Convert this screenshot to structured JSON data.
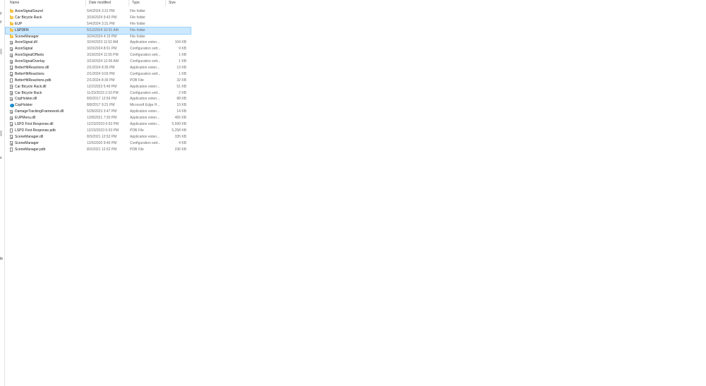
{
  "columns": {
    "name": "Name",
    "date": "Date modified",
    "type": "Type",
    "size": "Size"
  },
  "sidebar_glyphs": [
    "y",
    "y",
    "s",
    "ib"
  ],
  "selected_index": 3,
  "files": [
    {
      "name": "AxonSignalSound",
      "date": "5/4/2024 3:31 PM",
      "type": "File folder",
      "size": "",
      "icon": "folder-icon"
    },
    {
      "name": "Car Bicycle Rack",
      "date": "3/18/2024 9:43 PM",
      "type": "File folder",
      "size": "",
      "icon": "folder-icon"
    },
    {
      "name": "EUP",
      "date": "5/4/2024 3:31 PM",
      "type": "File folder",
      "size": "",
      "icon": "folder-icon"
    },
    {
      "name": "LSPDFR",
      "date": "5/12/2024 10:51 AM",
      "type": "File folder",
      "size": "",
      "icon": "folder-icon"
    },
    {
      "name": "SceneManager",
      "date": "3/24/2024 4:15 PM",
      "type": "File folder",
      "size": "",
      "icon": "folder-icon"
    },
    {
      "name": "AxonSignal.dll",
      "date": "3/24/2023 11:52 AM",
      "type": "Application exten...",
      "size": "104 KB",
      "icon": "dll-icon"
    },
    {
      "name": "AxonSignal",
      "date": "3/20/2024 8:01 PM",
      "type": "Configuration sett...",
      "size": "9 KB",
      "icon": "config-icon"
    },
    {
      "name": "AxonSignalOffsets",
      "date": "3/18/2024 11:55 PM",
      "type": "Configuration sett...",
      "size": "1 KB",
      "icon": "config-icon"
    },
    {
      "name": "AxonSignalOverlay",
      "date": "3/19/2024 12:06 AM",
      "type": "Configuration sett...",
      "size": "1 KB",
      "icon": "config-icon"
    },
    {
      "name": "BetterHitReactions.dll",
      "date": "2/1/2024 8:35 PM",
      "type": "Application exten...",
      "size": "13 KB",
      "icon": "dll-icon"
    },
    {
      "name": "BetterHitReactions",
      "date": "2/1/2024 9:03 PM",
      "type": "Configuration sett...",
      "size": "1 KB",
      "icon": "config-icon"
    },
    {
      "name": "BetterHitReactions.pdb",
      "date": "2/1/2024 8:35 PM",
      "type": "PDB File",
      "size": "32 KB",
      "icon": "file-icon"
    },
    {
      "name": "Car Bicycle Rack.dll",
      "date": "12/2/2023 5:49 PM",
      "type": "Application exten...",
      "size": "51 KB",
      "icon": "dll-icon"
    },
    {
      "name": "Car Bicycle Rack",
      "date": "11/23/2023 2:33 PM",
      "type": "Configuration sett...",
      "size": "2 KB",
      "icon": "config-icon"
    },
    {
      "name": "CopHolster.dll",
      "date": "8/9/2017 12:56 PM",
      "type": "Application exten...",
      "size": "88 KB",
      "icon": "dll-icon"
    },
    {
      "name": "CopHolster",
      "date": "8/8/2017 9:21 PM",
      "type": "Microsoft Edge H...",
      "size": "10 KB",
      "icon": "edge-icon"
    },
    {
      "name": "DamageTrackingFramework.dll",
      "date": "5/28/2023 3:47 PM",
      "type": "Application exten...",
      "size": "14 KB",
      "icon": "dll-icon"
    },
    {
      "name": "EUPMenu.dll",
      "date": "12/8/2021 7:30 PM",
      "type": "Application exten...",
      "size": "465 KB",
      "icon": "dll-icon"
    },
    {
      "name": "LSPD First Response.dll",
      "date": "12/23/2023 6:53 PM",
      "type": "Application exten...",
      "size": "5,590 KB",
      "icon": "dll-icon"
    },
    {
      "name": "LSPD First Response.pdb",
      "date": "12/23/2023 6:53 PM",
      "type": "PDB File",
      "size": "5,258 KB",
      "icon": "file-icon"
    },
    {
      "name": "SceneManager.dll",
      "date": "8/3/2021 12:52 PM",
      "type": "Application exten...",
      "size": "335 KB",
      "icon": "dll-icon"
    },
    {
      "name": "SceneManager",
      "date": "12/6/2020 9:46 PM",
      "type": "Configuration sett...",
      "size": "4 KB",
      "icon": "config-icon"
    },
    {
      "name": "SceneManager.pdb",
      "date": "8/3/2021 12:52 PM",
      "type": "PDB File",
      "size": "236 KB",
      "icon": "file-icon"
    }
  ]
}
